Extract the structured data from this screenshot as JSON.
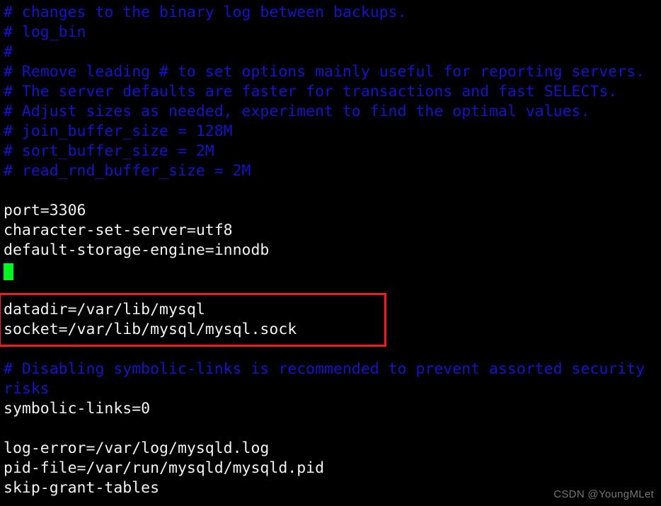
{
  "terminal": {
    "background_color": "#000000",
    "comment_color": "#1414c8",
    "text_color": "#f2f2f2",
    "cursor_color": "#00f522",
    "annotation_color": "#ee1c24"
  },
  "lines": [
    {
      "text": "# changes to the binary log between backups.",
      "kind": "comment"
    },
    {
      "text": "# log_bin",
      "kind": "comment"
    },
    {
      "text": "#",
      "kind": "comment"
    },
    {
      "text": "# Remove leading # to set options mainly useful for reporting servers.",
      "kind": "comment"
    },
    {
      "text": "# The server defaults are faster for transactions and fast SELECTs.",
      "kind": "comment"
    },
    {
      "text": "# Adjust sizes as needed, experiment to find the optimal values.",
      "kind": "comment"
    },
    {
      "text": "# join_buffer_size = 128M",
      "kind": "comment"
    },
    {
      "text": "# sort_buffer_size = 2M",
      "kind": "comment"
    },
    {
      "text": "# read_rnd_buffer_size = 2M",
      "kind": "comment"
    },
    {
      "text": "",
      "kind": "blank"
    },
    {
      "text": "port=3306",
      "kind": "plain"
    },
    {
      "text": "character-set-server=utf8",
      "kind": "plain"
    },
    {
      "text": "default-storage-engine=innodb",
      "kind": "plain"
    },
    {
      "text": "",
      "kind": "cursor"
    },
    {
      "text": "",
      "kind": "blank"
    },
    {
      "text": "datadir=/var/lib/mysql",
      "kind": "plain"
    },
    {
      "text": "socket=/var/lib/mysql/mysql.sock",
      "kind": "plain"
    },
    {
      "text": "",
      "kind": "blank"
    },
    {
      "text": "# Disabling symbolic-links is recommended to prevent assorted security",
      "kind": "comment"
    },
    {
      "text": "risks",
      "kind": "comment"
    },
    {
      "text": "symbolic-links=0",
      "kind": "plain"
    },
    {
      "text": "",
      "kind": "blank"
    },
    {
      "text": "log-error=/var/log/mysqld.log",
      "kind": "plain"
    },
    {
      "text": "pid-file=/var/run/mysqld/mysqld.pid",
      "kind": "plain"
    },
    {
      "text": "skip-grant-tables",
      "kind": "plain"
    }
  ],
  "annotation": {
    "label": "highlight-datadir-socket",
    "covers_lines": [
      "datadir=/var/lib/mysql",
      "socket=/var/lib/mysql/mysql.sock"
    ]
  },
  "watermark": {
    "text": "CSDN @YoungMLet"
  }
}
